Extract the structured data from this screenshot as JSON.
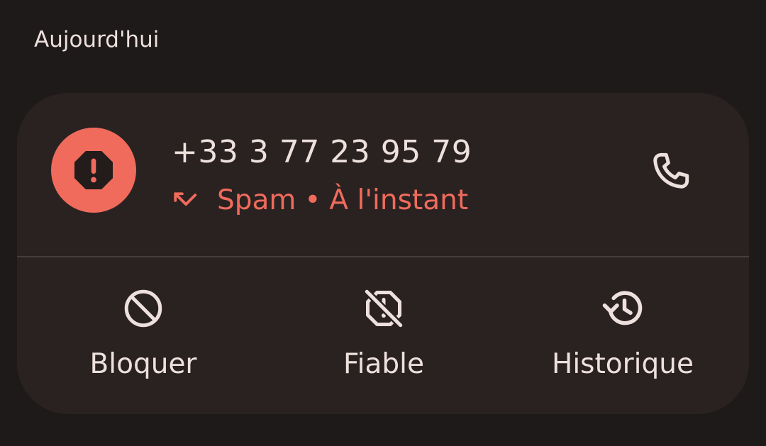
{
  "section": {
    "title": "Aujourd'hui"
  },
  "call": {
    "number": "+33 3 77 23 95 79",
    "label": "Spam",
    "separator": "•",
    "time": "À l'instant"
  },
  "actions": [
    {
      "label": "Bloquer",
      "icon": "block-icon"
    },
    {
      "label": "Fiable",
      "icon": "not-spam-icon"
    },
    {
      "label": "Historique",
      "icon": "history-icon"
    }
  ],
  "colors": {
    "background": "#1e1a19",
    "card": "#2a2221",
    "accent": "#f06b5c",
    "text": "#ede0dd"
  }
}
